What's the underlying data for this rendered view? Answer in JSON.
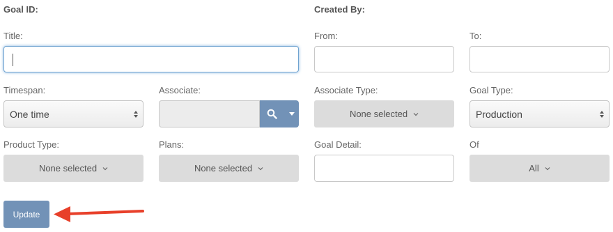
{
  "headers": {
    "goal_id": "Goal ID:",
    "created_by": "Created By:"
  },
  "labels": {
    "title": "Title:",
    "from": "From:",
    "to": "To:",
    "timespan": "Timespan:",
    "associate": "Associate:",
    "associate_type": "Associate Type:",
    "goal_type": "Goal Type:",
    "product_type": "Product Type:",
    "plans": "Plans:",
    "goal_detail": "Goal Detail:",
    "of": "Of"
  },
  "fields": {
    "title_value": "",
    "from_value": "",
    "to_value": "",
    "goal_detail_value": "",
    "associate_value": ""
  },
  "selects": {
    "timespan": "One time",
    "goal_type": "Production",
    "associate_type": "None selected",
    "product_type": "None selected",
    "plans": "None selected",
    "of": "All"
  },
  "button": {
    "update": "Update"
  },
  "colors": {
    "accent": "#7292b7",
    "annotation_arrow": "#e8402a",
    "focus": "#6fa3d0"
  },
  "icons": {
    "search": "search-icon",
    "dropdown": "caret-down-icon",
    "chevron": "chevron-down-icon",
    "sort": "sort-arrows-icon",
    "arrow": "arrow-left-icon"
  }
}
